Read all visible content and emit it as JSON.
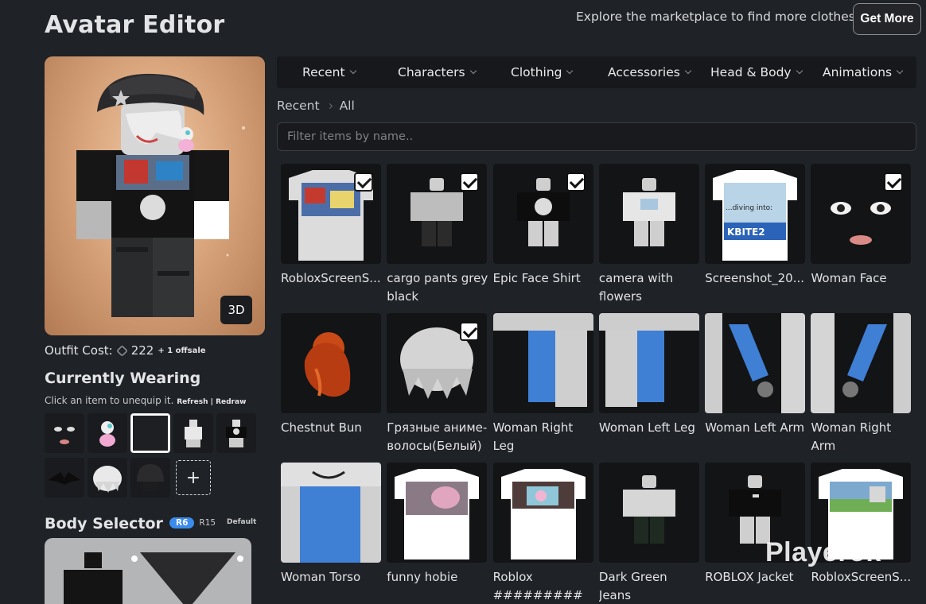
{
  "header": {
    "title": "Avatar Editor",
    "explore_text": "Explore the marketplace to find more clothes!",
    "get_more_label": "Get More"
  },
  "preview": {
    "toggle_3d_label": "3D"
  },
  "outfit": {
    "cost_label": "Outfit Cost:",
    "cost_value": "222",
    "offsale_text": "+ 1 offsale"
  },
  "currently_wearing": {
    "title": "Currently Wearing",
    "hint": "Click an item to unequip it.",
    "refresh_label": "Refresh",
    "separator": "|",
    "redraw_label": "Redraw",
    "add_label": "+"
  },
  "body_selector": {
    "title": "Body Selector",
    "r6_label": "R6",
    "r15_label": "R15",
    "default_label": "Default"
  },
  "tabs": [
    {
      "label": "Recent"
    },
    {
      "label": "Characters"
    },
    {
      "label": "Clothing"
    },
    {
      "label": "Accessories"
    },
    {
      "label": "Head & Body"
    },
    {
      "label": "Animations"
    }
  ],
  "breadcrumb": {
    "parent": "Recent",
    "current": "All"
  },
  "filter": {
    "placeholder": "Filter items by name.."
  },
  "items": [
    {
      "label": "RobloxScreenS...",
      "checked": true
    },
    {
      "label": "cargo pants grey black",
      "checked": true
    },
    {
      "label": "Epic Face Shirt",
      "checked": true
    },
    {
      "label": "camera with flowers",
      "checked": false
    },
    {
      "label": "Screenshot_20...",
      "checked": false
    },
    {
      "label": "Woman Face",
      "checked": true
    },
    {
      "label": "Chestnut Bun",
      "checked": false
    },
    {
      "label": "Грязные аниме-волосы(Белый)",
      "checked": true
    },
    {
      "label": "Woman Right Leg",
      "checked": false
    },
    {
      "label": "Woman Left Leg",
      "checked": false
    },
    {
      "label": "Woman Left Arm",
      "checked": false
    },
    {
      "label": "Woman Right Arm",
      "checked": false
    },
    {
      "label": "Woman Torso",
      "checked": false
    },
    {
      "label": "funny hobie",
      "checked": false
    },
    {
      "label": "Roblox #########",
      "checked": false
    },
    {
      "label": "Dark Green Jeans",
      "checked": false
    },
    {
      "label": "ROBLOX Jacket",
      "checked": false
    },
    {
      "label": "RobloxScreenS...",
      "checked": false
    }
  ],
  "thumb_texts": {
    "screenshot_caption": "...diving into:",
    "screenshot_logo": "KBITE2"
  },
  "watermark": "Playerok",
  "colors": {
    "background": "#1f2227",
    "tab_bar": "#17181b",
    "thumb": "#131416",
    "accent_blue": "#3b8bea"
  }
}
